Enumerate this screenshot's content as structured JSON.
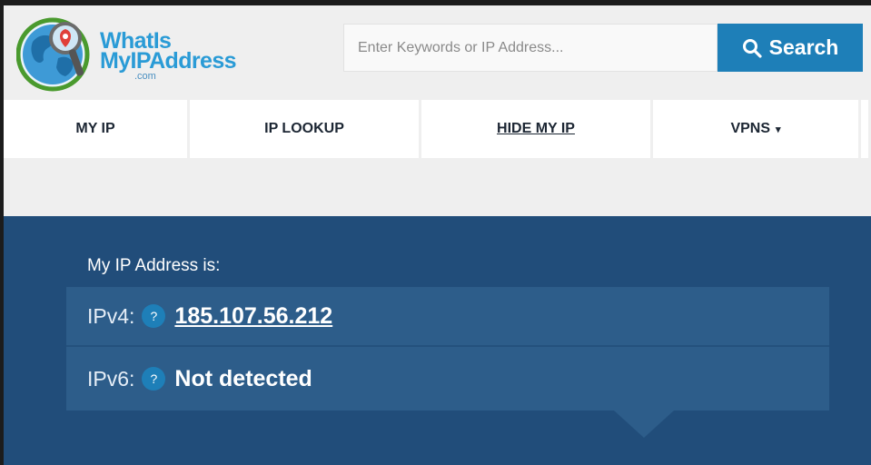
{
  "header": {
    "logo": {
      "line1": "WhatIs",
      "line2": "MyIPAddress",
      "dotcom": ".com"
    },
    "search": {
      "placeholder": "Enter Keywords or IP Address...",
      "button_label": "Search"
    }
  },
  "nav": {
    "items": [
      {
        "label": "MY IP"
      },
      {
        "label": "IP LOOKUP"
      },
      {
        "label": "HIDE MY IP"
      },
      {
        "label": "VPNS",
        "arrow": "▾"
      }
    ]
  },
  "hero": {
    "title": "My IP Address is:",
    "ipv4_label": "IPv4:",
    "ipv4_value": "185.107.56.212",
    "ipv6_label": "IPv6:",
    "ipv6_value": "Not detected",
    "help_glyph": "?"
  },
  "colors": {
    "brand_blue": "#1e7fb8",
    "hero_bg": "#214d7a",
    "ip_box_bg": "#2d5d8a",
    "nav_text": "#1c2633"
  }
}
